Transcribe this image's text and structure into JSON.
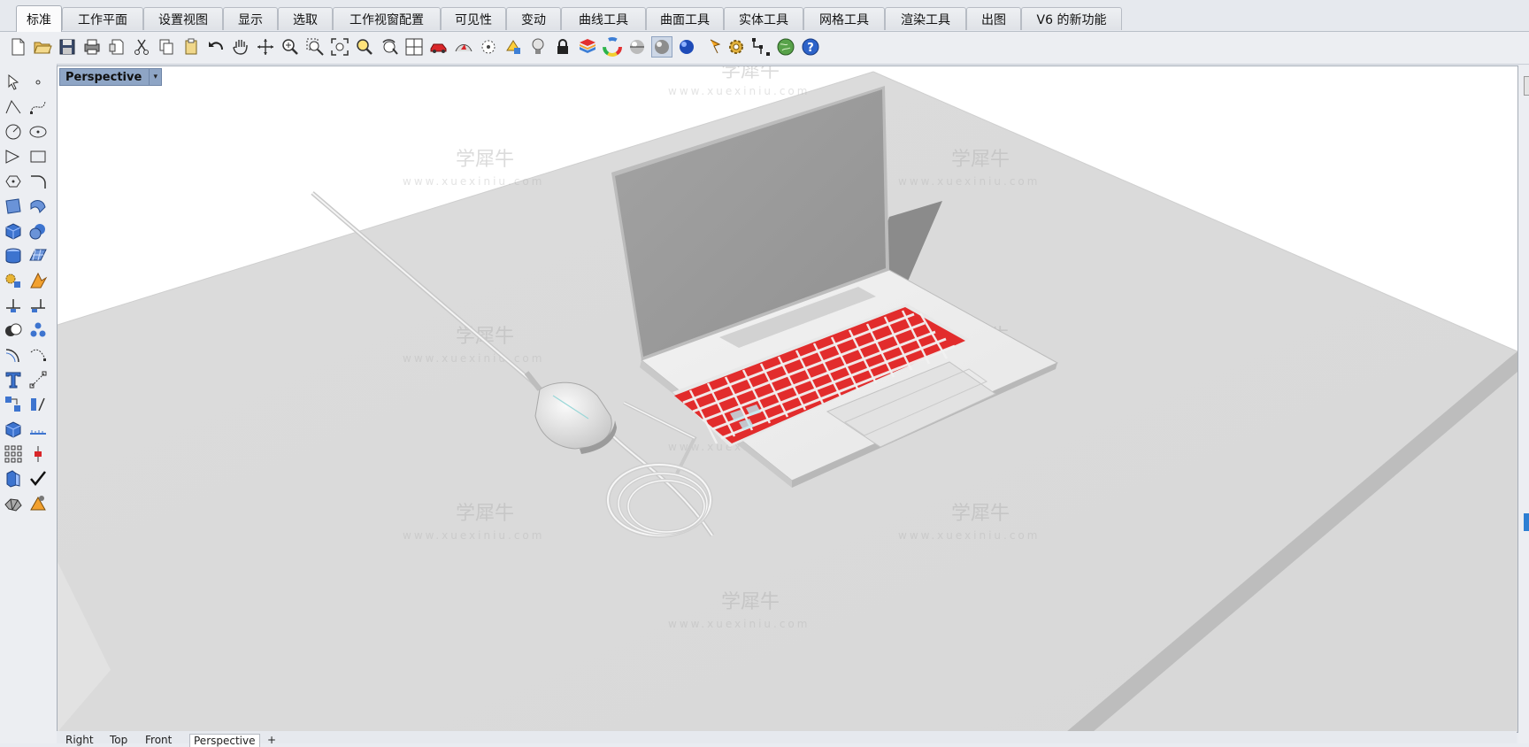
{
  "tabs": [
    {
      "label": "标准",
      "active": true
    },
    {
      "label": "工作平面"
    },
    {
      "label": "设置视图"
    },
    {
      "label": "显示"
    },
    {
      "label": "选取"
    },
    {
      "label": "工作视窗配置"
    },
    {
      "label": "可见性"
    },
    {
      "label": "变动"
    },
    {
      "label": "曲线工具"
    },
    {
      "label": "曲面工具"
    },
    {
      "label": "实体工具"
    },
    {
      "label": "网格工具"
    },
    {
      "label": "渲染工具"
    },
    {
      "label": "出图"
    },
    {
      "label": "V6 的新功能"
    }
  ],
  "toolbar": {
    "icons": [
      "new-file-icon",
      "open-file-icon",
      "save-icon",
      "print-icon",
      "import-icon",
      "cut-icon",
      "copy-icon",
      "paste-icon",
      "undo-icon",
      "pan-hand-icon",
      "rotate-view-icon",
      "zoom-icon",
      "zoom-window-icon",
      "zoom-extents-icon",
      "zoom-selected-icon",
      "undo-view-icon",
      "four-viewports-icon",
      "car-icon",
      "shading-icon",
      "hide-icon",
      "show-objects-icon",
      "light-icon",
      "lock-icon",
      "layer-icon",
      "color-wheel-icon",
      "render-sphere-icon",
      "render-shaded-icon",
      "blue-sphere-icon",
      "flag-icon",
      "options-gear-icon",
      "snap-icon",
      "globe-icon",
      "help-icon"
    ]
  },
  "left_toolbar": {
    "icons": [
      "select-arrow-icon",
      "point-icon",
      "polyline-icon",
      "curve-icon",
      "circle-icon",
      "ellipse-icon",
      "polygon-icon",
      "rectangle-icon",
      "arc-icon",
      "fillet-curve-icon",
      "surface-icon",
      "extrude-surface-icon",
      "box-icon",
      "sphere-icon",
      "cylinder-icon",
      "plane-icon",
      "explode-icon",
      "trim-icon",
      "split-icon",
      "join-icon",
      "boolean-icon",
      "group-icon",
      "offset-icon",
      "blend-curve-icon",
      "text-icon",
      "dimension-icon",
      "array-icon",
      "align-icon",
      "block-icon",
      "measure-icon",
      "grid-icon",
      "ortho-icon",
      "properties-icon",
      "check-icon",
      "mesh-icon",
      "render-icon"
    ]
  },
  "viewport": {
    "title": "Perspective",
    "caret": "▾",
    "watermark_text": "学犀牛",
    "watermark_url": "www.xuexiniu.com"
  },
  "bottom_tabs": [
    {
      "label": "Right"
    },
    {
      "label": "Top"
    },
    {
      "label": "Front"
    },
    {
      "label": "Perspective",
      "active": true
    },
    {
      "label": "+"
    }
  ],
  "colors": {
    "keyboard": "#e11b1b",
    "screen": "#9c9c9c",
    "table_top": "#dadada",
    "viewport_title_bg": "#8ea5c5"
  }
}
